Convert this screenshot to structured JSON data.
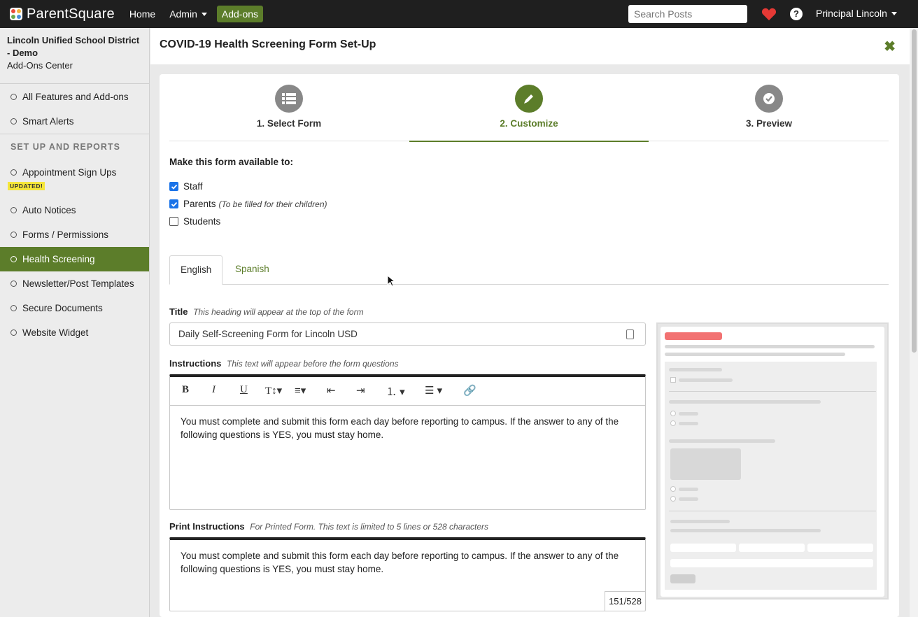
{
  "app": {
    "logo_text": "ParentSquare",
    "nav": {
      "home": "Home",
      "admin": "Admin",
      "addons": "Add-ons"
    },
    "search_placeholder": "Search Posts",
    "user": "Principal Lincoln"
  },
  "sidebar": {
    "org_name": "Lincoln Unified School District - Demo",
    "org_sub": "Add-Ons Center",
    "top_items": [
      "All Features and Add-ons",
      "Smart Alerts"
    ],
    "section_title": "SET UP AND REPORTS",
    "updated_badge": "UPDATED!",
    "items": [
      "Appointment Sign Ups",
      "Auto Notices",
      "Forms / Permissions",
      "Health Screening",
      "Newsletter/Post Templates",
      "Secure Documents",
      "Website Widget"
    ],
    "active_item": "Health Screening"
  },
  "page": {
    "title": "COVID-19 Health Screening Form Set-Up",
    "steps": [
      "1. Select Form",
      "2. Customize",
      "3. Preview"
    ],
    "active_step": 1,
    "availability": {
      "title": "Make this form available to:",
      "options": [
        {
          "label": "Staff",
          "checked": true,
          "hint": ""
        },
        {
          "label": "Parents",
          "checked": true,
          "hint": "(To be filled for their children)"
        },
        {
          "label": "Students",
          "checked": false,
          "hint": ""
        }
      ]
    },
    "language_tabs": [
      "English",
      "Spanish"
    ],
    "active_language": "English",
    "title_field": {
      "label": "Title",
      "hint": "This heading will appear at the top of the form",
      "value": "Daily Self-Screening Form for Lincoln USD"
    },
    "instructions": {
      "label": "Instructions",
      "hint": "This text will appear before the form questions",
      "text": "You must complete and submit this form each day before reporting to campus. If the answer to any of the following questions is YES, you must stay home."
    },
    "print_instructions": {
      "label": "Print Instructions",
      "hint": "For Printed Form. This text is limited to 5 lines or 528 characters",
      "text": "You must complete and submit this form each day before reporting to campus. If the answer to any of the following questions is YES, you must stay home.",
      "counter": "151/528"
    }
  },
  "colors": {
    "brand_green": "#5c7d2a",
    "topbar": "#1f1f1f",
    "heart": "#e53935",
    "checkbox_blue": "#1a73e8"
  }
}
